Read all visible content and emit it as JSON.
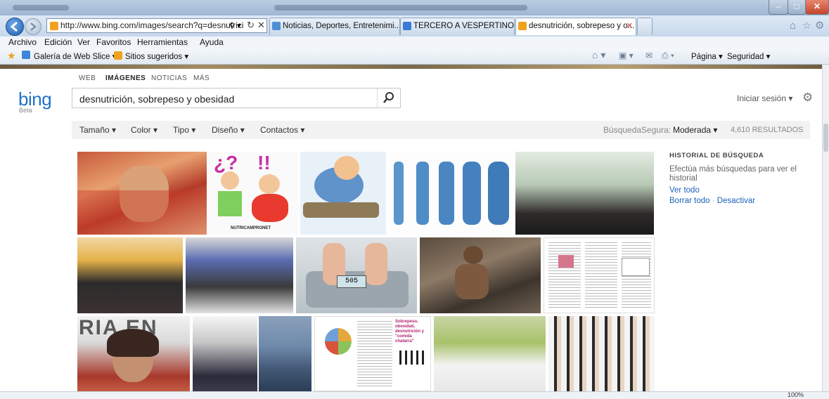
{
  "browser": {
    "address": "http://www.bing.com/images/search?q=desnutrici",
    "tabs": [
      {
        "label": "Noticias, Deportes, Entretenimi...",
        "active": false
      },
      {
        "label": "TERCERO A VESPERTINO - Go...",
        "active": false
      },
      {
        "label": "desnutrición, sobrepeso y o...",
        "active": true
      }
    ],
    "menu": [
      "Archivo",
      "Edición",
      "Ver",
      "Favoritos",
      "Herramientas",
      "Ayuda"
    ],
    "favorites": {
      "web_slice": "Galería de Web Slice ▾",
      "suggested": "Sitios sugeridos ▾"
    },
    "commandbar": {
      "page": "Página ▾",
      "security": "Seguridad ▾"
    },
    "zoom": "100%"
  },
  "bing": {
    "logo": "bing",
    "beta": "Beta",
    "nav": [
      "WEB",
      "IMÁGENES",
      "NOTICIAS",
      "MÁS"
    ],
    "query": "desnutrición, sobrepeso y obesidad",
    "signin": "Iniciar sesión ▾",
    "filters": [
      "Tamaño ▾",
      "Color ▾",
      "Tipo ▾",
      "Diseño ▾",
      "Contactos ▾"
    ],
    "safesearch_label": "BúsquedaSegura:",
    "safesearch_value": "Moderada ▾",
    "results": "4,610 RESULTADOS",
    "history": {
      "title": "HISTORIAL DE BÚSQUEDA",
      "text": "Efectúa más búsquedas para ver el historial",
      "see_all": "Ver todo",
      "clear_all": "Borrar todo",
      "separator": "·",
      "disable": "Desactivar"
    },
    "image_captions": {
      "brand": "NUTRICAMPRONET",
      "scale": "505",
      "banner": "Sobrepeso, obesidad, desnutrición y \"comida chatarra\""
    }
  },
  "colors": {
    "bing_blue": "#1f72c4",
    "link": "#1a62b9",
    "titlebar": "#a9bfd9"
  }
}
